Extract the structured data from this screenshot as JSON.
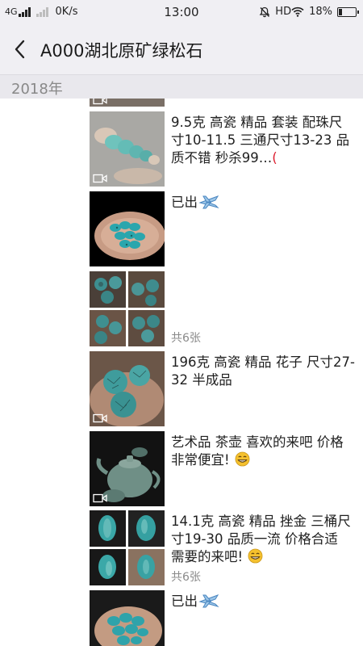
{
  "status_bar": {
    "network": "4G",
    "speed": "0K/s",
    "time": "13:00",
    "hd": "HD",
    "battery": "18%",
    "battery_level": 0.18
  },
  "header": {
    "title": "A000湖北原矿绿松石",
    "back_icon": "chevron-left-icon"
  },
  "year": "2018年",
  "posts": [
    {
      "text": "9.5克 高瓷 精品 套装 配珠尺寸10-11.5 三通尺寸13-23 品质不错 秒杀99…",
      "icon": "video-icon"
    },
    {
      "text": "已出",
      "icon": "airplane-icon"
    },
    {
      "count": "共6张"
    },
    {
      "text": "196克 高瓷 精品 花子 尺寸27-32 半成品",
      "icon": "video-icon"
    },
    {
      "text": "艺术品 茶壶 喜欢的来吧 价格非常便宜!",
      "icon": "grin-emoji-icon"
    },
    {
      "text": "14.1克 高瓷 精品 挫金 三桶尺寸19-30 品质一流 价格合适 需要的来吧!",
      "count": "共6张",
      "icon": "grin-emoji-icon"
    },
    {
      "text": "已出",
      "icon": "airplane-icon"
    }
  ],
  "colors": {
    "header_bg": "#f0eff3",
    "year_bg": "#e9e8ed",
    "turquoise": "#3aa8a8",
    "emoji": "#f5c12e"
  }
}
